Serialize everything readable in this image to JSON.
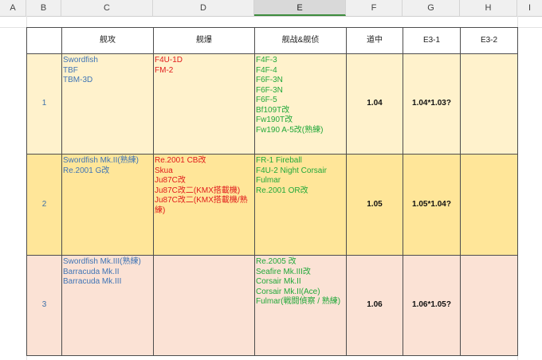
{
  "column_letters": [
    "A",
    "B",
    "C",
    "D",
    "E",
    "F",
    "G",
    "H",
    "I"
  ],
  "selected_column": "E",
  "header": {
    "b": "",
    "c": "舰攻",
    "d": "舰爆",
    "e": "舰战&舰侦",
    "f": "道中",
    "g": "E3-1",
    "h": "E3-2"
  },
  "rows": [
    {
      "num": "1",
      "torpedo": [
        "Swordfish",
        "TBF",
        "TBM-3D"
      ],
      "dive": [
        "F4U-1D",
        "FM-2"
      ],
      "fighter": [
        "F4F-3",
        "F4F-4",
        "F6F-3N",
        "F6F-3N",
        "F6F-5",
        "Bf109T改",
        "Fw190T改",
        "Fw190 A-5改(熟練)"
      ],
      "route": "1.04",
      "e31": "1.04*1.03?",
      "e32": ""
    },
    {
      "num": "2",
      "torpedo": [
        "Swordfish Mk.II(熟練)",
        "Re.2001 G改"
      ],
      "dive": [
        "Re.2001 CB改",
        "Skua",
        "Ju87C改",
        "Ju87C改二(KMX搭載機)",
        "Ju87C改二(KMX搭載機/熟練)"
      ],
      "fighter": [
        "FR-1 Fireball",
        "F4U-2 Night Corsair",
        "Fulmar",
        "Re.2001 OR改"
      ],
      "route": "1.05",
      "e31": "1.05*1.04?",
      "e32": ""
    },
    {
      "num": "3",
      "torpedo": [
        "Swordfish Mk.III(熟練)",
        "Barracuda Mk.II",
        "Barracuda Mk.III"
      ],
      "dive": [],
      "fighter": [
        "Re.2005 改",
        "Seafire Mk.III改",
        "Corsair Mk.II",
        "Corsair Mk.II(Ace)",
        "Fulmar(戦闘偵察 / 熟練)"
      ],
      "route": "1.06",
      "e31": "1.06*1.05?",
      "e32": ""
    }
  ],
  "colors": {
    "row1_fill": "#fff2cc",
    "row2_fill": "#ffe699",
    "row3_fill": "#fbe2d5",
    "torpedo_text": "#3f74b5",
    "dive_text": "#e01b1b",
    "fighter_text": "#22a83a"
  }
}
